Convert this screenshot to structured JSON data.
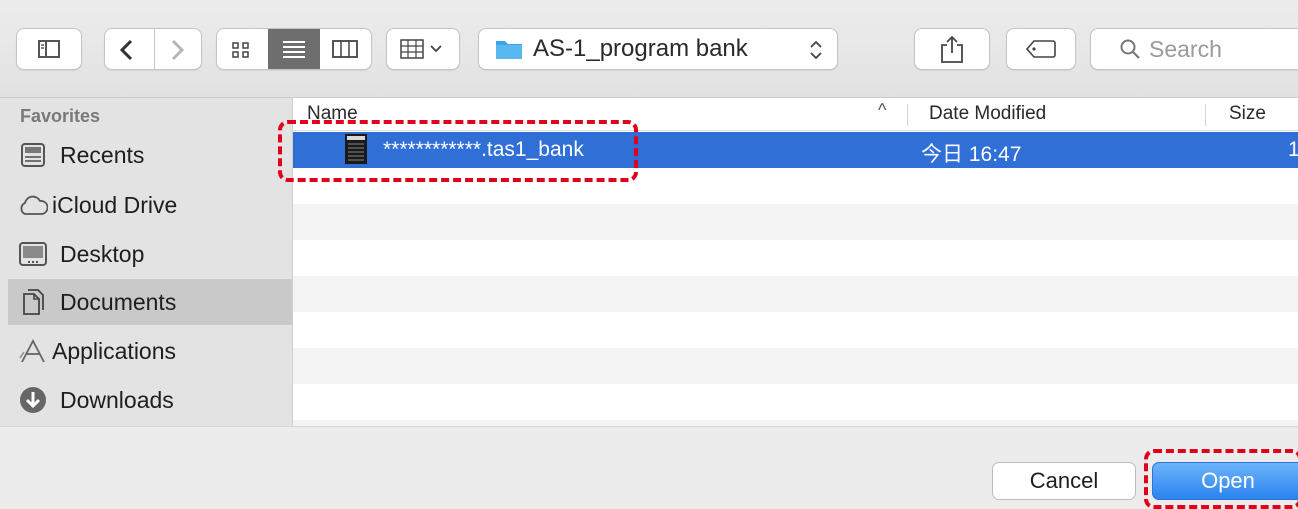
{
  "toolbar": {
    "location": "AS-1_program bank",
    "search_placeholder": "Search",
    "icons": [
      "sidebar-icon",
      "back-icon",
      "forward-icon",
      "icon-view-icon",
      "list-view-icon",
      "column-view-icon",
      "group-icon",
      "folder-icon",
      "updown-icon",
      "share-icon",
      "tag-icon",
      "search-icon"
    ]
  },
  "sidebar": {
    "heading": "Favorites",
    "items": [
      {
        "label": "Recents",
        "icon": "recents-icon"
      },
      {
        "label": "iCloud Drive",
        "icon": "cloud-icon"
      },
      {
        "label": "Desktop",
        "icon": "desktop-icon"
      },
      {
        "label": "Documents",
        "icon": "documents-icon",
        "selected": true
      },
      {
        "label": "Applications",
        "icon": "applications-icon"
      },
      {
        "label": "Downloads",
        "icon": "downloads-icon"
      }
    ]
  },
  "filelist": {
    "columns": {
      "name": "Name",
      "date": "Date Modified",
      "size": "Size"
    },
    "sort_indicator": "^",
    "rows": [
      {
        "name": "************.tas1_bank",
        "date": "今日 16:47",
        "size": "1"
      }
    ]
  },
  "buttons": {
    "cancel": "Cancel",
    "open": "Open"
  },
  "colors": {
    "selection": "#2f6fd6",
    "annotation": "#e0001b",
    "open_button": "#2a83f0"
  }
}
